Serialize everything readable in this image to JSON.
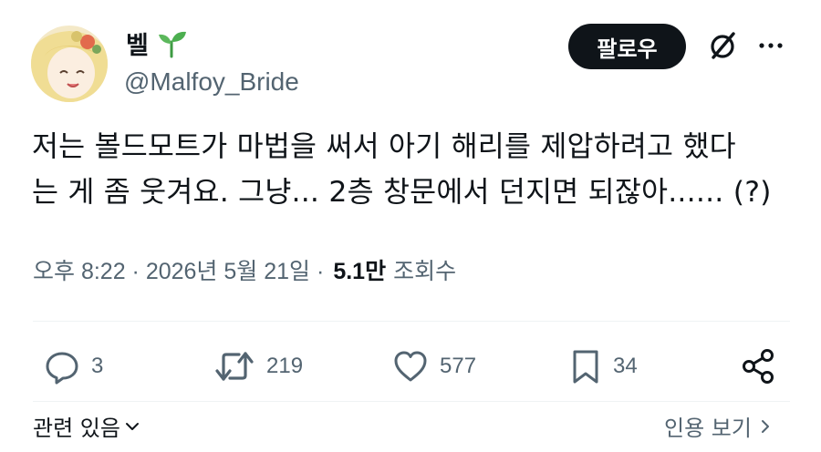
{
  "author": {
    "display_name": "벨",
    "name_emoji": "seedling-icon",
    "handle": "@Malfoy_Bride"
  },
  "header": {
    "follow_label": "팔로우",
    "grok_icon": "grok-icon",
    "more_icon": "more-icon"
  },
  "tweet": {
    "lines": [
      "저는 볼드모트가 마법을 써서 아기 해리를 제압하려고 했다",
      "는 게 좀 웃겨요. 그냥... 2층 창문에서 던지면 되잖아...... (?)"
    ]
  },
  "meta": {
    "time": "오후 8:22 · 2026년 5월 21일 ·",
    "views_count": "5.1만",
    "views_label": "조회수"
  },
  "actions": {
    "replies": "3",
    "retweets": "219",
    "likes": "577",
    "bookmarks": "34"
  },
  "footer": {
    "related_label": "관련 있음",
    "translate_label": "인용 보기"
  },
  "colors": {
    "text_primary": "#0f1419",
    "text_secondary": "#536471",
    "button_bg": "#0f1419",
    "seedling": "#4caf50"
  }
}
